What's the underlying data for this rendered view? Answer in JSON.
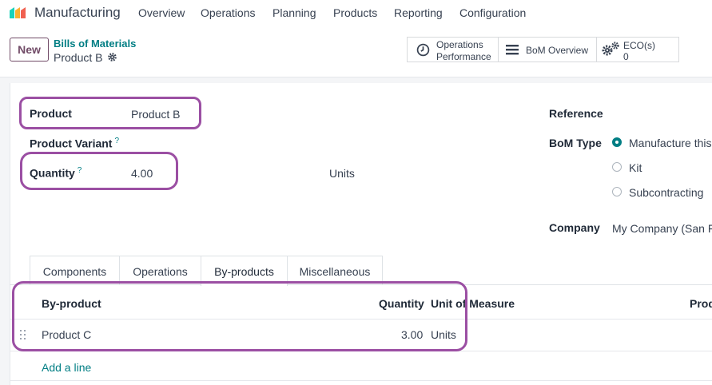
{
  "app": {
    "name": "Manufacturing",
    "menu": [
      "Overview",
      "Operations",
      "Planning",
      "Products",
      "Reporting",
      "Configuration"
    ]
  },
  "control_panel": {
    "new_label": "New",
    "breadcrumb": "Bills of Materials",
    "record": "Product B",
    "smart_buttons": {
      "operations_line1": "Operations",
      "operations_line2": "Performance",
      "bom_overview": "BoM Overview",
      "eco_label": "ECO(s)",
      "eco_count": "0"
    }
  },
  "form": {
    "product_label": "Product",
    "product_value": "Product B",
    "variant_label": "Product Variant",
    "help_mark": "?",
    "quantity_label": "Quantity",
    "quantity_value": "4.00",
    "quantity_uom": "Units",
    "reference_label": "Reference",
    "bom_type_label": "BoM Type",
    "bom_types": [
      "Manufacture this",
      "Kit",
      "Subcontracting"
    ],
    "bom_type_selected": "Manufacture this",
    "company_label": "Company",
    "company_value": "My Company (San Fr"
  },
  "tabs": [
    "Components",
    "Operations",
    "By-products",
    "Miscellaneous"
  ],
  "active_tab": "By-products",
  "byproducts_table": {
    "headers": {
      "product": "By-product",
      "quantity": "Quantity",
      "uom": "Unit of Measure",
      "extra": "Prod"
    },
    "rows": [
      {
        "product": "Product C",
        "quantity": "3.00",
        "uom": "Units"
      }
    ],
    "add_line": "Add a line"
  },
  "colors": {
    "accent": "#714b67",
    "link": "#017e84",
    "highlight": "#9b4fa3"
  }
}
